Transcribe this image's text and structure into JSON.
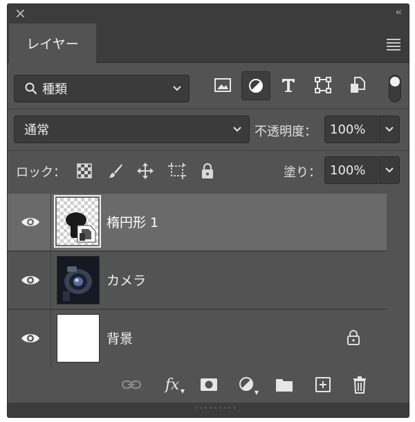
{
  "panel": {
    "tab_label": "レイヤー",
    "filter": {
      "value": "種類"
    },
    "blend_mode": {
      "value": "通常"
    },
    "opacity": {
      "label": "不透明度：",
      "value": "100%"
    },
    "lock": {
      "label": "ロック："
    },
    "fill": {
      "label": "塗り：",
      "value": "100%"
    },
    "layers": [
      {
        "name": "楕円形 1",
        "visible": true,
        "selected": true,
        "locked": false,
        "kind": "shape-smart-object"
      },
      {
        "name": "カメラ",
        "visible": true,
        "selected": false,
        "locked": false,
        "kind": "image"
      },
      {
        "name": "背景",
        "visible": true,
        "selected": false,
        "locked": true,
        "kind": "background"
      }
    ],
    "bottom_fx_label": "fx"
  },
  "colors": {
    "panel_bg": "#535353",
    "field_bg": "#3b3b3b",
    "selected_row": "#6a6a6a",
    "titlebar": "#3c3c3c"
  },
  "icons": {
    "filter_types": [
      "image-filter-icon",
      "adjustment-filter-icon",
      "type-filter-icon",
      "shape-filter-icon",
      "smart-object-filter-icon"
    ],
    "locks": [
      "lock-transparent-pixels-icon",
      "lock-image-pixels-icon",
      "lock-position-icon",
      "lock-artboard-icon",
      "lock-all-icon"
    ],
    "bottom": [
      "link-layers-icon",
      "add-style-icon",
      "add-mask-icon",
      "new-adjustment-layer-icon",
      "new-group-icon",
      "new-layer-icon",
      "delete-layer-icon"
    ]
  }
}
